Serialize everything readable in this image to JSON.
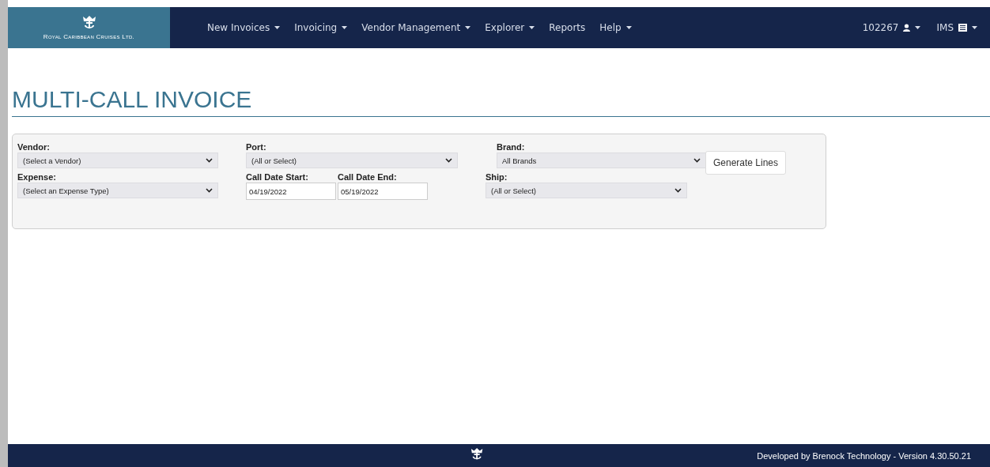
{
  "brand": {
    "logo_text": "Royal Caribbean Cruises Ltd."
  },
  "nav": [
    {
      "label": "New Invoices",
      "dropdown": true
    },
    {
      "label": "Invoicing",
      "dropdown": true
    },
    {
      "label": "Vendor Management",
      "dropdown": true
    },
    {
      "label": "Explorer",
      "dropdown": true
    },
    {
      "label": "Reports",
      "dropdown": false
    },
    {
      "label": "Help",
      "dropdown": true
    }
  ],
  "nav_right": [
    {
      "label": "102267",
      "kind": "user"
    },
    {
      "label": "IMS",
      "kind": "app"
    }
  ],
  "title": "MULTI-CALL INVOICE",
  "form": {
    "vendor": {
      "label": "Vendor:",
      "value": "(Select a Vendor)"
    },
    "expense": {
      "label": "Expense:",
      "value": "(Select an Expense Type)"
    },
    "port": {
      "label": "Port:",
      "value": "(All or Select)"
    },
    "call_date_start": {
      "label": "Call Date Start:",
      "value": "04/19/2022"
    },
    "call_date_end": {
      "label": "Call Date End:",
      "value": "05/19/2022"
    },
    "brand": {
      "label": "Brand:",
      "value": "All Brands"
    },
    "ship": {
      "label": "Ship:",
      "value": "(All or Select)"
    },
    "button": "Generate Lines"
  },
  "footer": {
    "text": "Developed by Brenock Technology - Version 4.30.50.21"
  }
}
